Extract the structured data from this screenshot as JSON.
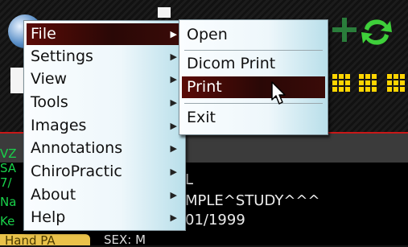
{
  "main_menu": {
    "items": [
      {
        "label": "File",
        "has_submenu": true,
        "highlighted": true
      },
      {
        "label": "Settings",
        "has_submenu": true
      },
      {
        "label": "View",
        "has_submenu": true
      },
      {
        "label": "Tools",
        "has_submenu": true
      },
      {
        "label": "Images",
        "has_submenu": true
      },
      {
        "label": "Annotations",
        "has_submenu": true
      },
      {
        "label": "ChiroPractic",
        "has_submenu": true
      },
      {
        "label": "About",
        "has_submenu": true
      },
      {
        "label": "Help",
        "has_submenu": true
      }
    ],
    "arrow_glyph": "▶"
  },
  "file_submenu": {
    "items": [
      {
        "label": "Open"
      },
      {
        "label": "Dicom Print"
      },
      {
        "label": "Print",
        "highlighted": true
      },
      {
        "label": "Exit"
      }
    ]
  },
  "background": {
    "side_labels": [
      "VZ",
      "SA",
      "7/",
      "Na",
      "Ke"
    ],
    "patient_lines": [
      "L",
      "MPLE^STUDY^^^",
      "01/1999"
    ],
    "bottom_tab": "Hand PA",
    "bottom_sex": "SEX: M"
  },
  "colors": {
    "highlight": "#3a0906",
    "menu_bg": "#eef7fb",
    "toolbar_yellow": "#ffd500",
    "side_label_green": "#19d14a",
    "accent_red": "#c81818"
  },
  "icons": [
    "app-logo-icon",
    "green-cross-icon",
    "refresh-icon",
    "grid-layout-icon",
    "mouse-cursor-icon"
  ]
}
